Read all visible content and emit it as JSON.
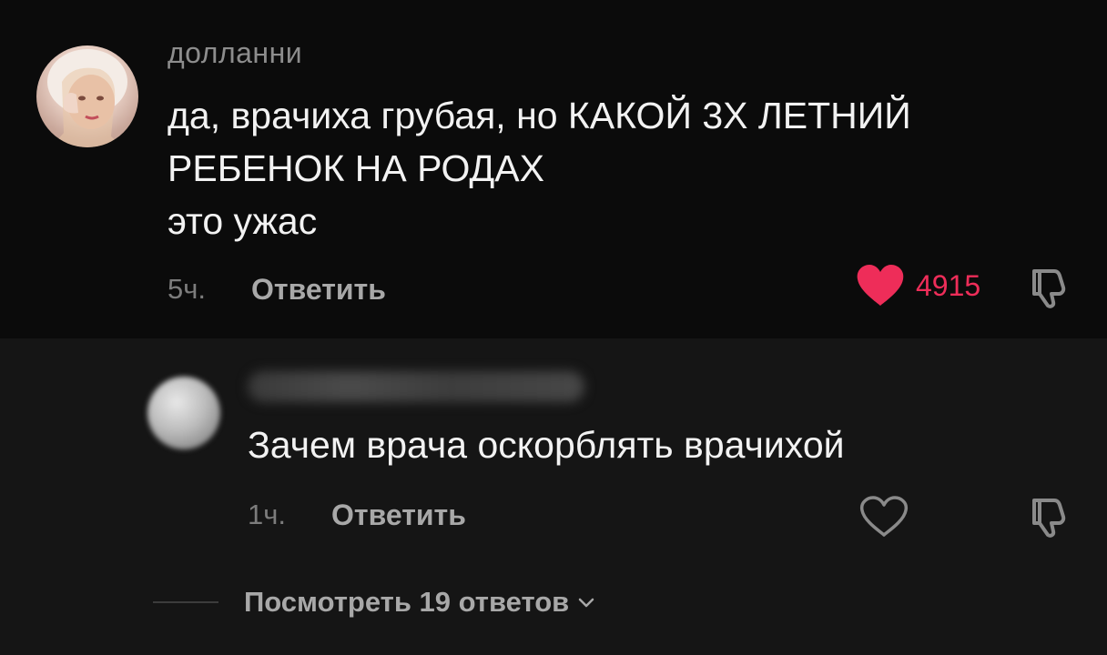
{
  "comment": {
    "username": "долланни",
    "text_lines": [
      "да, врачиха грубая, но КАКОЙ 3Х ЛЕТНИЙ",
      "РЕБЕНОК НА РОДАХ",
      "это ужас"
    ],
    "time": "5ч.",
    "reply_label": "Ответить",
    "likes": "4915",
    "liked": true,
    "icons": {
      "avatar": "avatar",
      "like": "heart-filled-icon",
      "dislike": "thumbs-down-icon"
    },
    "colors": {
      "like": "#ee2d59"
    }
  },
  "reply": {
    "username_blurred": true,
    "text": "Зачем врача оскорблять врачихой",
    "time": "1ч.",
    "reply_label": "Ответить",
    "liked": false,
    "icons": {
      "avatar": "avatar",
      "like": "heart-outline-icon",
      "dislike": "thumbs-down-icon"
    }
  },
  "view_replies": {
    "label": "Посмотреть 19 ответов",
    "icon": "chevron-down-icon"
  }
}
